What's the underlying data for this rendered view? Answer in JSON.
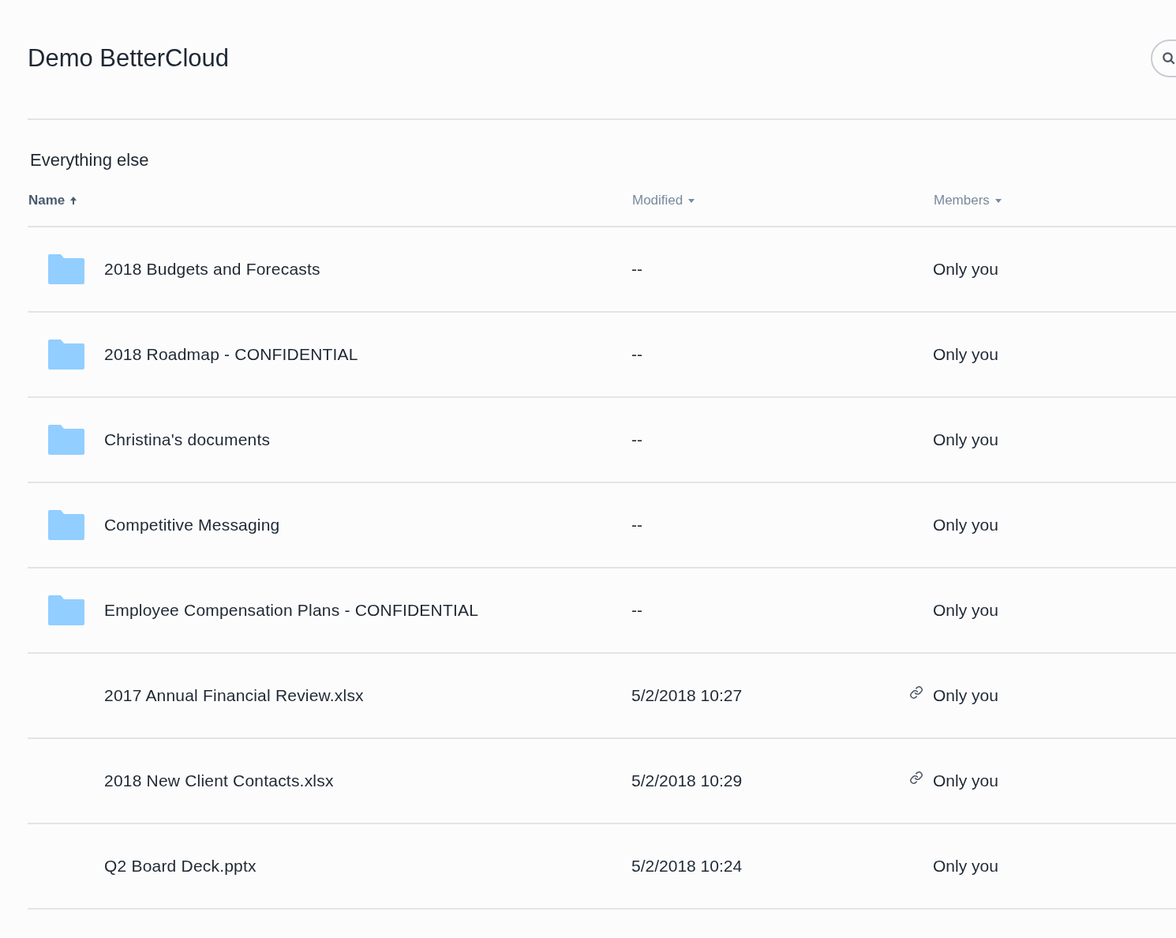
{
  "header": {
    "title": "Demo BetterCloud"
  },
  "section": {
    "title": "Everything else"
  },
  "table": {
    "columns": [
      {
        "label": "Name",
        "selected": true
      },
      {
        "label": "Modified",
        "selected": false
      },
      {
        "label": "Members",
        "selected": false
      }
    ],
    "rows": [
      {
        "kind": "folder",
        "name": "2018 Budgets and Forecasts",
        "modified": "--",
        "members": "Only you",
        "shared": false
      },
      {
        "kind": "folder",
        "name": "2018 Roadmap - CONFIDENTIAL",
        "modified": "--",
        "members": "Only you",
        "shared": false
      },
      {
        "kind": "folder",
        "name": "Christina's documents",
        "modified": "--",
        "members": "Only you",
        "shared": false
      },
      {
        "kind": "folder",
        "name": "Competitive Messaging",
        "modified": "--",
        "members": "Only you",
        "shared": false
      },
      {
        "kind": "folder",
        "name": "Employee Compensation Plans - CONFIDENTIAL",
        "modified": "--",
        "members": "Only you",
        "shared": false
      },
      {
        "kind": "file",
        "name": "2017 Annual Financial Review.xlsx",
        "modified": "5/2/2018 10:27",
        "members": "Only you",
        "shared": true
      },
      {
        "kind": "file",
        "name": "2018 New Client Contacts.xlsx",
        "modified": "5/2/2018 10:29",
        "members": "Only you",
        "shared": true
      },
      {
        "kind": "file",
        "name": "Q2 Board Deck.pptx",
        "modified": "5/2/2018 10:24",
        "members": "Only you",
        "shared": false
      }
    ]
  }
}
